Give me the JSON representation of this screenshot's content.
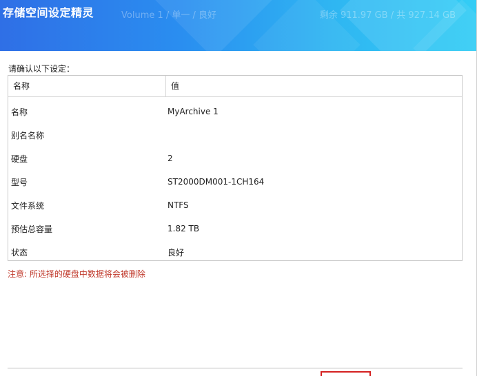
{
  "header": {
    "title": "存储空间设定精灵",
    "subtitle": "Volume 1 / 单一 / 良好",
    "capacity": "剩余 911.97 GB / 共 927.14 GB"
  },
  "prompt": "请确认以下设定：",
  "table": {
    "headers": [
      "名称",
      "值"
    ],
    "rows": [
      {
        "label": "名称",
        "value": "MyArchive 1"
      },
      {
        "label": "别名名称",
        "value": ""
      },
      {
        "label": "硬盘",
        "value": "2"
      },
      {
        "label": "型号",
        "value": "ST2000DM001-1CH164"
      },
      {
        "label": "文件系统",
        "value": "NTFS"
      },
      {
        "label": "预估总容量",
        "value": "1.82 TB"
      },
      {
        "label": "状态",
        "value": "良好"
      }
    ]
  },
  "warning": "注意: 所选择的硬盘中数据将会被删除",
  "colors": {
    "header_gradient_start": "#2f6fe6",
    "header_gradient_end": "#33cdf5",
    "warning": "#c0392b",
    "highlight_border": "#d42020"
  }
}
